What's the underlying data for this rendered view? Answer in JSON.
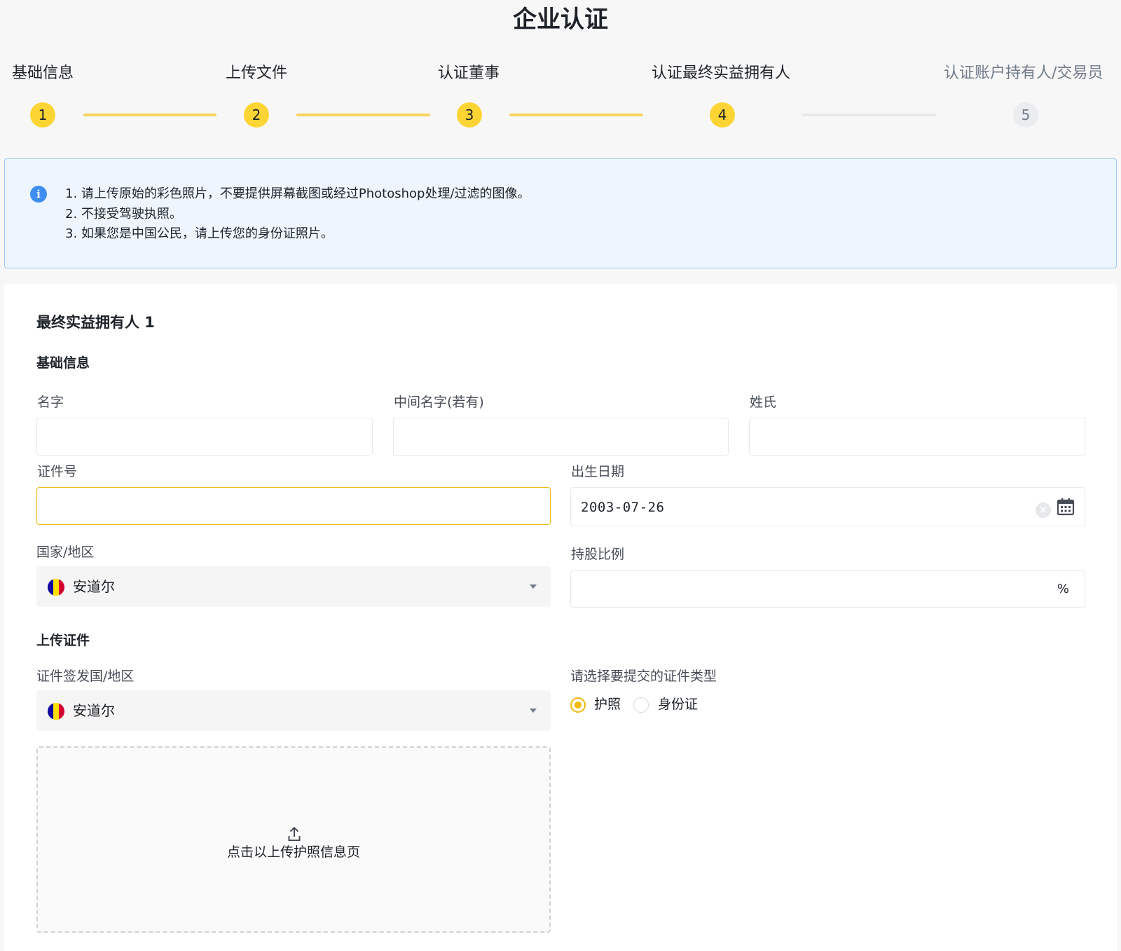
{
  "page": {
    "title": "企业认证"
  },
  "stepper": {
    "steps": [
      {
        "label": "基础信息",
        "number": "1",
        "status": "done"
      },
      {
        "label": "上传文件",
        "number": "2",
        "status": "done"
      },
      {
        "label": "认证董事",
        "number": "3",
        "status": "done"
      },
      {
        "label": "认证最终实益拥有人",
        "number": "4",
        "status": "current"
      },
      {
        "label": "认证账户持有人/交易员",
        "number": "5",
        "status": "todo"
      }
    ]
  },
  "notice": {
    "icon": "info-icon",
    "lines": [
      "1. 请上传原始的彩色照片，不要提供屏幕截图或经过Photoshop处理/过滤的图像。",
      "2. 不接受驾驶执照。",
      "3. 如果您是中国公民，请上传您的身份证照片。"
    ]
  },
  "form": {
    "owner_title": "最终实益拥有人 1",
    "basic_section": "基础信息",
    "first_name": {
      "label": "名字",
      "value": ""
    },
    "middle_name": {
      "label": "中间名字(若有)",
      "value": ""
    },
    "last_name": {
      "label": "姓氏",
      "value": ""
    },
    "id_number": {
      "label": "证件号",
      "value": ""
    },
    "birth_date": {
      "label": "出生日期",
      "value": "2003-07-26"
    },
    "country": {
      "label": "国家/地区",
      "value": "安道尔"
    },
    "shareholding": {
      "label": "持股比例",
      "value": "",
      "suffix": "%"
    },
    "upload_section": "上传证件",
    "issuing_country": {
      "label": "证件签发国/地区",
      "value": "安道尔"
    },
    "doc_type": {
      "label": "请选择要提交的证件类型",
      "options": [
        "护照",
        "身份证"
      ],
      "selected": "护照"
    },
    "upload_box": {
      "text": "点击以上传护照信息页"
    }
  },
  "colors": {
    "accent": "#f0b90b",
    "step_done": "#fcd535",
    "notice_bg": "#edf6fe",
    "notice_border": "#9ecaf2",
    "info_icon": "#3e8ef0",
    "flag_andorra": [
      "#10069f",
      "#fedf00",
      "#d50032"
    ]
  }
}
